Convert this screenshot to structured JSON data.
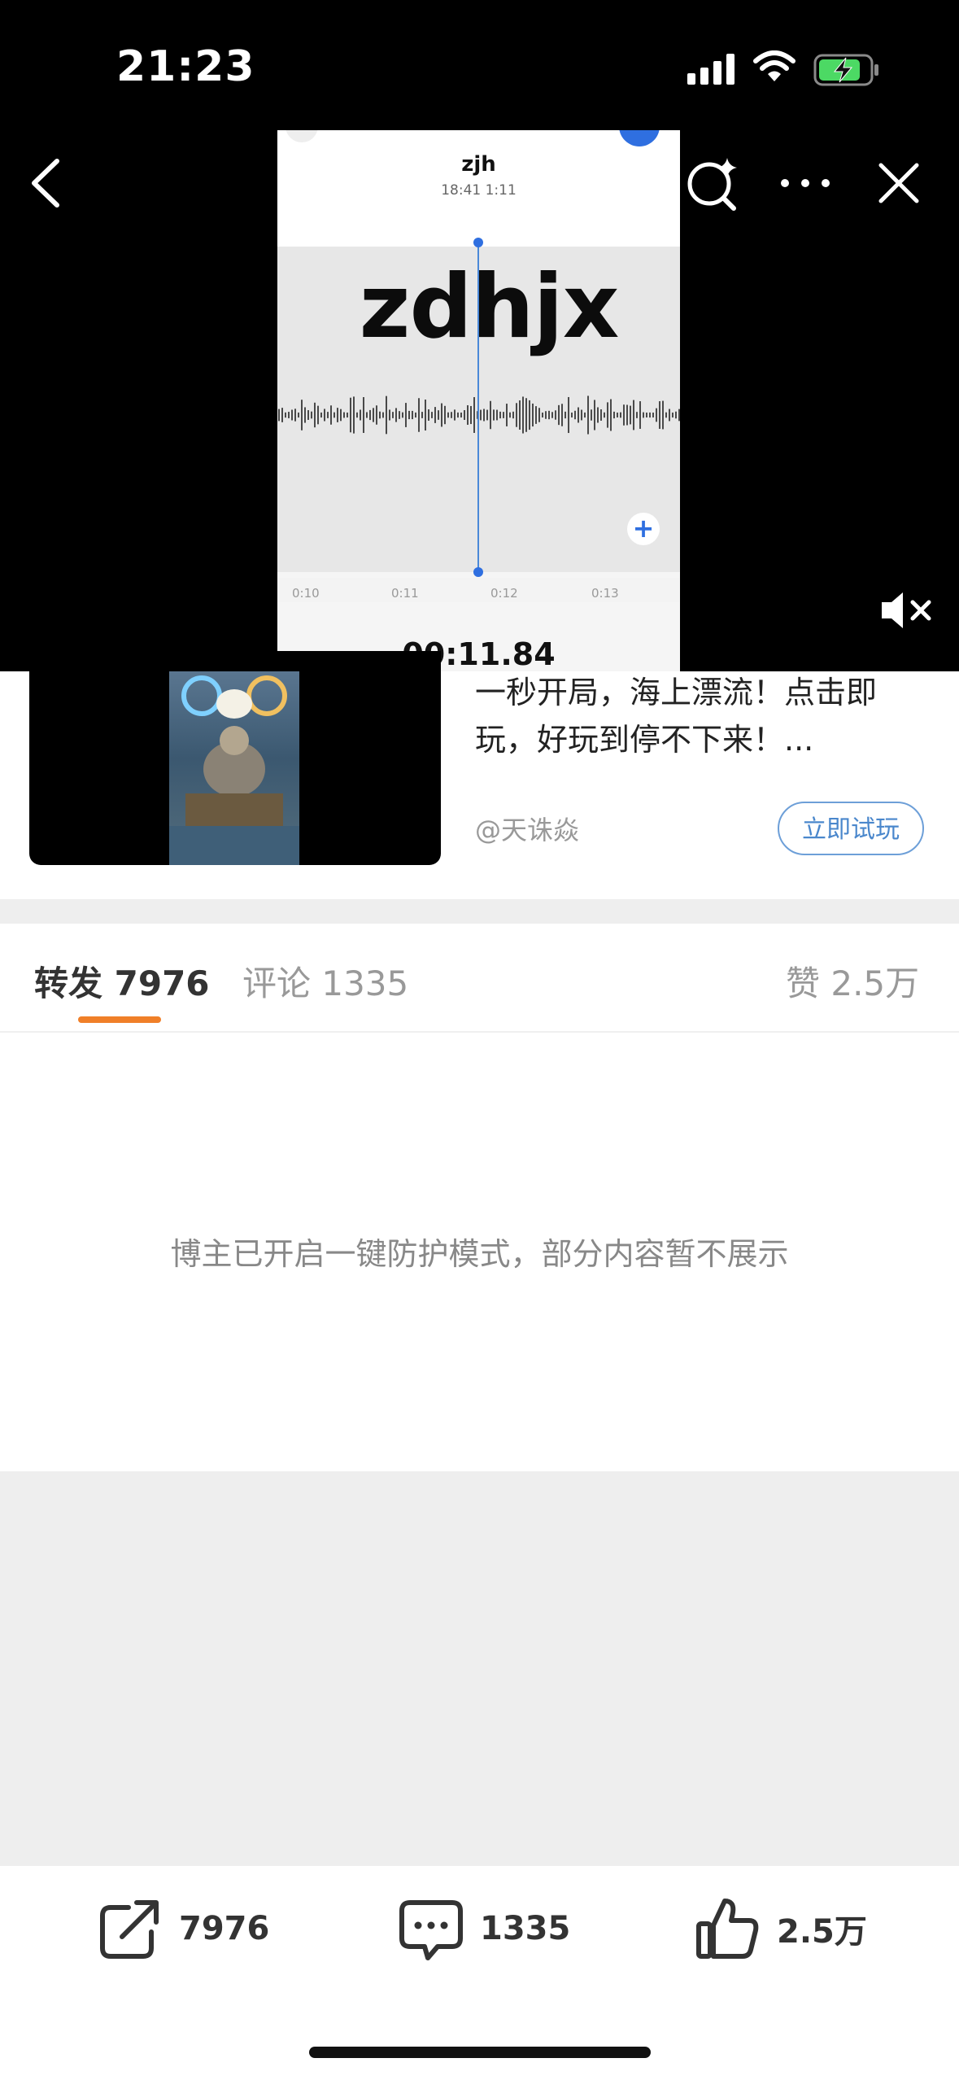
{
  "status_bar": {
    "time": "21:23"
  },
  "video": {
    "recording_name": "zjh",
    "recording_meta": "18:41  1:11",
    "transcript_text": "zdhjx",
    "timeline_ticks": [
      "0:10",
      "0:11",
      "0:12",
      "0:13"
    ],
    "elapsed": "00:11.84",
    "plus_label": "+"
  },
  "ad": {
    "text": "一秒开局，海上漂流！点击即玩，好玩到停不下来！...",
    "author": "@天诛焱",
    "cta": "立即试玩"
  },
  "tabs": {
    "repost": "转发 7976",
    "comment": "评论 1335",
    "like": "赞 2.5万"
  },
  "protect_message": "博主已开启一键防护模式，部分内容暂不展示",
  "bottom_bar": {
    "repost_count": "7976",
    "comment_count": "1335",
    "like_count": "2.5万"
  },
  "colors": {
    "accent_orange": "#f07f28",
    "link_blue": "#4a87cc",
    "voice_blue": "#2f6fe0"
  }
}
